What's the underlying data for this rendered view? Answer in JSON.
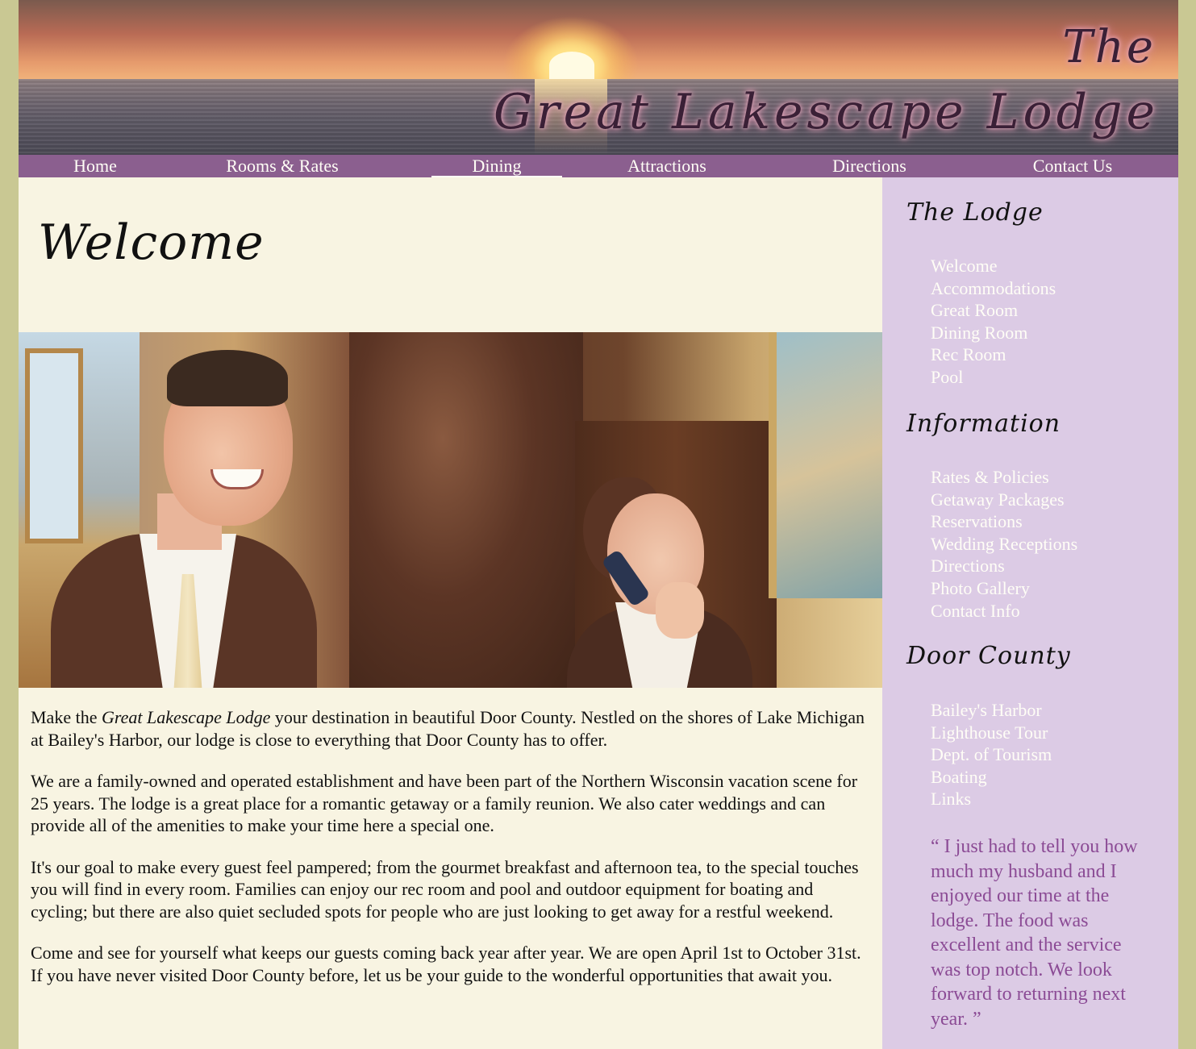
{
  "banner": {
    "title_line1": "The",
    "title_line2": "Great Lakescape Lodge"
  },
  "nav": {
    "items": [
      {
        "label": "Home"
      },
      {
        "label": "Rooms & Rates"
      },
      {
        "label": "Dining"
      },
      {
        "label": "Attractions"
      },
      {
        "label": "Directions"
      },
      {
        "label": "Contact Us"
      }
    ],
    "active": "Dining"
  },
  "main": {
    "heading": "Welcome",
    "paragraphs": [
      {
        "p1_before": "Make the ",
        "p1_emph": "Great Lakescape Lodge",
        "p1_after": " your destination in beautiful Door County. Nestled on the shores of Lake Michigan at Bailey's Harbor, our lodge is close to everything that Door County has to offer."
      },
      "We are a family-owned and operated establishment and have been part of the Northern Wisconsin vacation scene for 25 years. The lodge is a great place for a romantic getaway or a family reunion. We also cater weddings and can provide all of the amenities to make your time here a special one.",
      "It's our goal to make every guest feel pampered; from the gourmet breakfast and afternoon tea, to the special touches you will find in every room. Families can enjoy our rec room and pool and outdoor equipment for boating and cycling; but there are also quiet secluded spots for people who are just looking to get away for a restful weekend.",
      "Come and see for yourself what keeps our guests coming back year after year. We are open April 1st to October 31st. If you have never visited Door County before, let us be your guide to the wonderful opportunities that await you."
    ]
  },
  "sidebar": {
    "lodge": {
      "heading": "The Lodge",
      "items": [
        "Welcome",
        "Accommodations",
        "Great Room",
        "Dining Room",
        "Rec Room",
        "Pool"
      ]
    },
    "information": {
      "heading": "Information",
      "items": [
        "Rates & Policies",
        "Getaway Packages",
        "Reservations",
        "Wedding Receptions",
        "Directions",
        "Photo Gallery",
        "Contact Info"
      ]
    },
    "door_county": {
      "heading": "Door County",
      "items": [
        "Bailey's Harbor",
        "Lighthouse Tour",
        "Dept. of Tourism",
        "Boating",
        "Links"
      ]
    },
    "testimonial": "“ I just had to tell you how much my husband and I enjoyed our time at the lodge. The food was excellent and the service was top notch. We look forward to returning next year. ”"
  },
  "colors": {
    "outer_background": "#c9c893",
    "content_background": "#f8f4e2",
    "nav_background": "#8b5f8f",
    "sidebar_background": "#dccbe5",
    "sidebar_link": "#fffef6",
    "testimonial_text": "#8b4b95"
  }
}
